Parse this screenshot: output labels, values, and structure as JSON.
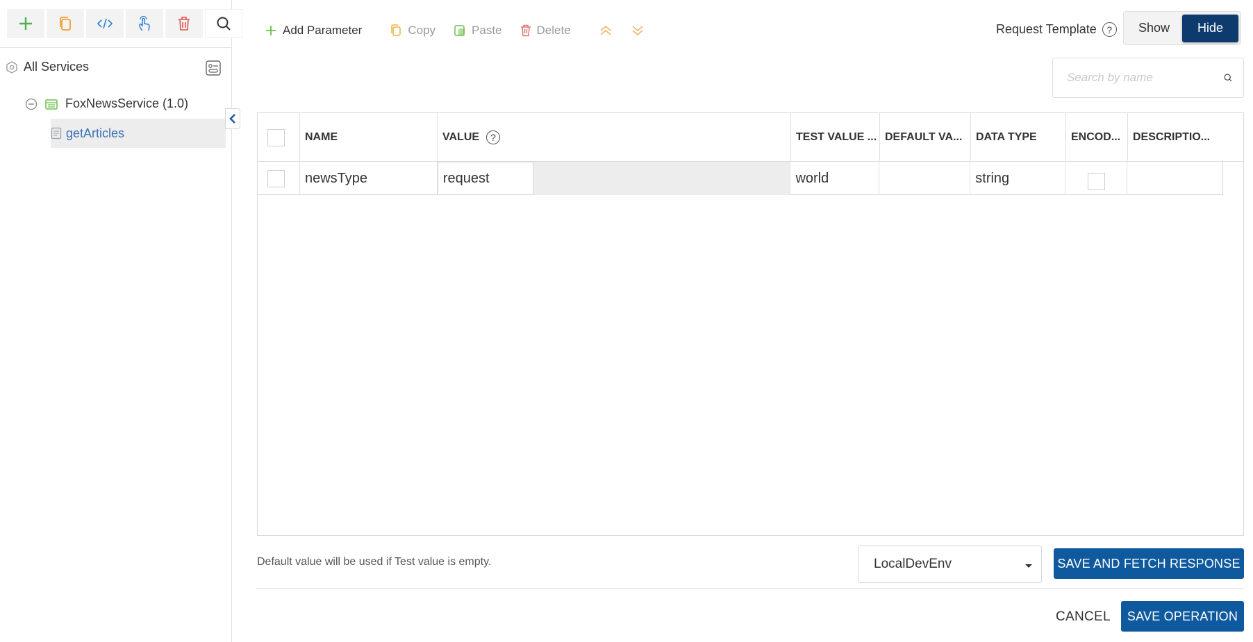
{
  "sidebar": {
    "toolbar": [
      {
        "name": "add",
        "icon": "plus-icon",
        "color": "#4caf50"
      },
      {
        "name": "copy",
        "icon": "copy-icon",
        "color": "#f0a030"
      },
      {
        "name": "code",
        "icon": "code-icon",
        "color": "#2a7fd4"
      },
      {
        "name": "touch",
        "icon": "touch-icon",
        "color": "#2a7fd4"
      },
      {
        "name": "delete",
        "icon": "trash-icon",
        "color": "#e05050"
      },
      {
        "name": "search",
        "icon": "search-icon",
        "color": "#333333"
      }
    ],
    "all_services": "All Services",
    "service": "FoxNewsService (1.0)",
    "operation": "getArticles"
  },
  "toolbar": {
    "add_parameter": "Add Parameter",
    "copy": "Copy",
    "paste": "Paste",
    "delete": "Delete"
  },
  "request_template": {
    "label": "Request Template",
    "help": "?",
    "show": "Show",
    "hide": "Hide",
    "active": "Hide"
  },
  "search": {
    "placeholder": "Search by name"
  },
  "table": {
    "columns": [
      "NAME",
      "VALUE",
      "TEST VALUE ...",
      "DEFAULT VA...",
      "DATA TYPE",
      "ENCOD...",
      "DESCRIPTIO..."
    ],
    "value_help": "?",
    "rows": [
      {
        "name": "newsType",
        "value": "request",
        "test_value": "world",
        "default_value": "",
        "data_type": "string",
        "encode": false,
        "description": ""
      }
    ]
  },
  "footer": {
    "hint": "Default value will be used if Test value is empty.",
    "environment": "LocalDevEnv",
    "save_fetch": "SAVE AND FETCH RESPONSE",
    "cancel": "CANCEL",
    "save_operation": "SAVE OPERATION"
  },
  "colors": {
    "primary": "#0f5a9e",
    "toggle_active": "#0e3b6e",
    "link": "#3a72b8"
  }
}
